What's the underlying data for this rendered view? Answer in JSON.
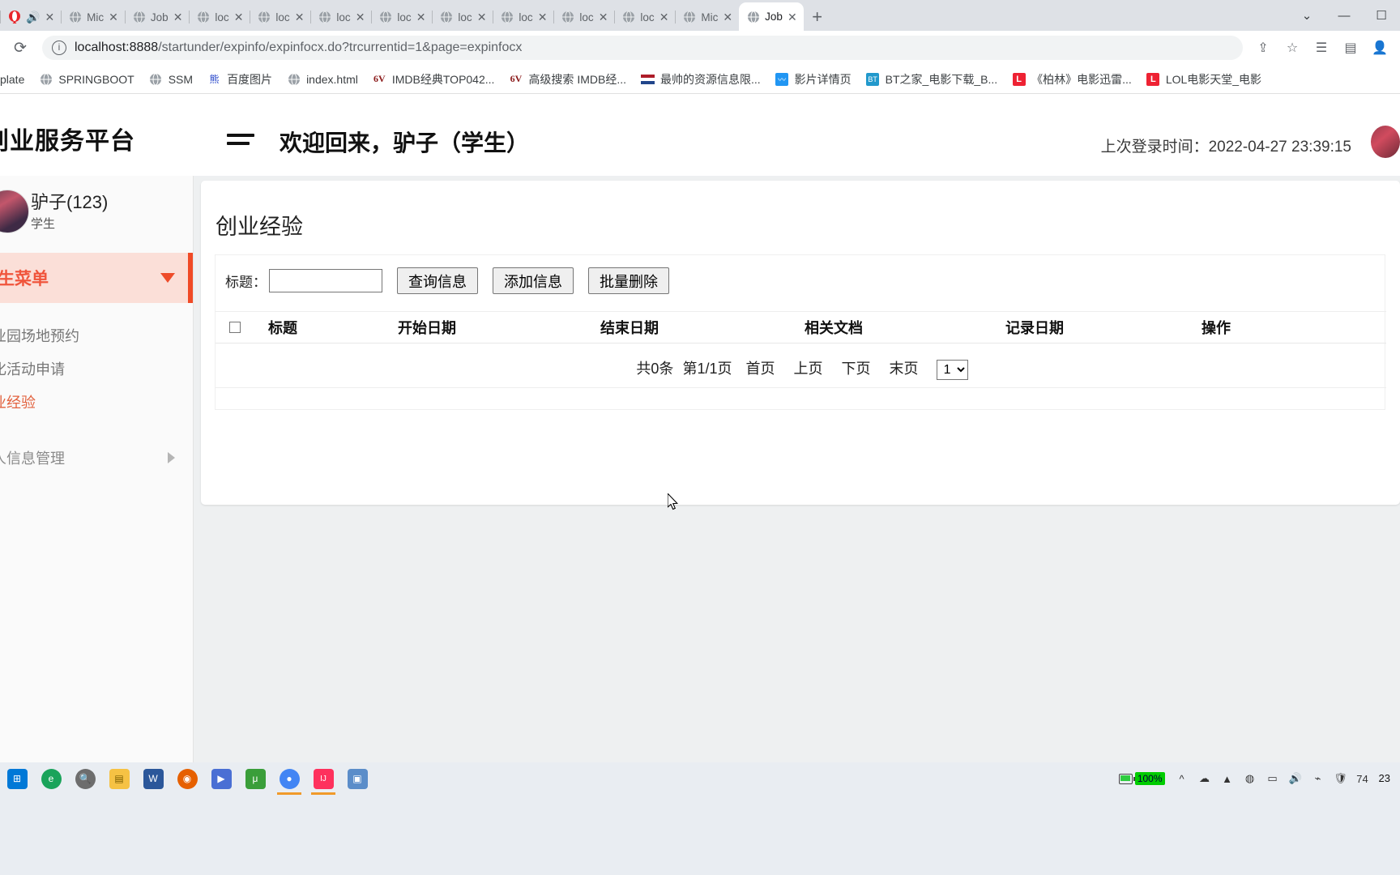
{
  "browser": {
    "tabs": [
      {
        "label": "",
        "icon": "opera-icon",
        "type": "special"
      },
      {
        "label": "Mic",
        "icon": "globe-icon"
      },
      {
        "label": "Job",
        "icon": "globe-icon"
      },
      {
        "label": "loc",
        "icon": "globe-icon"
      },
      {
        "label": "loc",
        "icon": "globe-icon"
      },
      {
        "label": "loc",
        "icon": "globe-icon"
      },
      {
        "label": "loc",
        "icon": "globe-icon"
      },
      {
        "label": "loc",
        "icon": "globe-icon"
      },
      {
        "label": "loc",
        "icon": "globe-icon"
      },
      {
        "label": "loc",
        "icon": "globe-icon"
      },
      {
        "label": "loc",
        "icon": "globe-icon"
      },
      {
        "label": "Mic",
        "icon": "globe-icon"
      },
      {
        "label": "Job",
        "icon": "globe-icon",
        "active": true
      }
    ],
    "new_tab_label": "+",
    "window_controls": {
      "minimize": "—",
      "maximize": "☐",
      "chevron": "⌄"
    },
    "reload_label": "⟳",
    "omnibox": {
      "host": "localhost:8888",
      "rest": "/startunder/expinfo/expinfocx.do?trcurrentid=1&page=expinfocx",
      "full_url": "localhost:8888/startunder/expinfo/expinfocx.do?trcurrentid=1&page=expinfocx"
    },
    "toolbar_icons": [
      "share-icon",
      "bookmark-star-icon",
      "reading-list-icon",
      "sidebar-icon",
      "profile-icon"
    ],
    "bookmarks": [
      {
        "label": "plate",
        "icon": "none"
      },
      {
        "label": "SPRINGBOOT",
        "icon": "globe-icon"
      },
      {
        "label": "SSM",
        "icon": "globe-icon"
      },
      {
        "label": "百度图片",
        "icon": "baidu-icon"
      },
      {
        "label": "index.html",
        "icon": "globe-icon"
      },
      {
        "label": "IMDB经典TOP042...",
        "icon": "6v-icon"
      },
      {
        "label": "高级搜索 IMDB经...",
        "icon": "6v-icon"
      },
      {
        "label": "最帅的资源信息限...",
        "icon": "flag-icon"
      },
      {
        "label": "影片详情页",
        "icon": "blue-icon"
      },
      {
        "label": "BT之家_电影下载_B...",
        "icon": "green-icon"
      },
      {
        "label": "《柏林》电影迅雷...",
        "icon": "red-l-icon"
      },
      {
        "label": "LOL电影天堂_电影",
        "icon": "red-l-icon"
      }
    ]
  },
  "app": {
    "brand": "生创业服务平台",
    "welcome": "欢迎回来，驴子（学生）",
    "last_login": "上次登录时间：2022-04-27 23:39:15"
  },
  "sidebar": {
    "user_name": "驴子(123)",
    "user_role": "学生",
    "menu_head": "学生菜单",
    "items": [
      {
        "label": "创业园场地预约",
        "active": false
      },
      {
        "label": "孵化活动申请",
        "active": false
      },
      {
        "label": "创业经验",
        "active": true
      }
    ],
    "group": {
      "label": "个人信息管理"
    }
  },
  "main": {
    "card_title": "创业经验",
    "search": {
      "label": "标题：",
      "value": "",
      "placeholder": ""
    },
    "buttons": {
      "query": "查询信息",
      "add": "添加信息",
      "batch_delete": "批量删除"
    },
    "table": {
      "columns": [
        {
          "key": "checkbox",
          "label": ""
        },
        {
          "key": "title",
          "label": "标题"
        },
        {
          "key": "start_date",
          "label": "开始日期"
        },
        {
          "key": "end_date",
          "label": "结束日期"
        },
        {
          "key": "doc",
          "label": "相关文档"
        },
        {
          "key": "record_date",
          "label": "记录日期"
        },
        {
          "key": "action",
          "label": "操作"
        }
      ],
      "rows": []
    },
    "pagination": {
      "total": "共0条",
      "page_info": "第1/1页",
      "first": "首页",
      "prev": "上页",
      "next": "下页",
      "last": "末页",
      "selected_page": "1",
      "options": [
        "1"
      ]
    }
  },
  "taskbar": {
    "items": [
      {
        "name": "start-button",
        "glyph": "⊞",
        "color": "#0078d7"
      },
      {
        "name": "edge-icon",
        "glyph": "e",
        "color": "#25a162"
      },
      {
        "name": "search-icon",
        "glyph": "○",
        "color": "#888"
      },
      {
        "name": "file-explorer-icon",
        "glyph": "▬",
        "color": "#f6c244"
      },
      {
        "name": "word-icon",
        "glyph": "W",
        "color": "#2b579a"
      },
      {
        "name": "firefox-icon",
        "glyph": "◉",
        "color": "#e66000"
      },
      {
        "name": "media-icon",
        "glyph": "▶",
        "color": "#4a6fd4"
      },
      {
        "name": "utorrent-icon",
        "glyph": "μ",
        "color": "#3a9e3a"
      },
      {
        "name": "chrome-icon",
        "glyph": "●",
        "color": "#4285f4"
      },
      {
        "name": "idea-icon",
        "glyph": "IJ",
        "color": "#fe315d"
      },
      {
        "name": "navicat-icon",
        "glyph": "▣",
        "color": "#5b8dc9"
      }
    ],
    "tray": {
      "battery_percent": "100%",
      "icons": [
        "chevron-up-icon",
        "onedrive-icon",
        "dropbox-icon",
        "chrome-tray-icon",
        "volume-icon",
        "network-icon",
        "shield-icon"
      ],
      "number_badge": "74",
      "time": "23"
    }
  }
}
